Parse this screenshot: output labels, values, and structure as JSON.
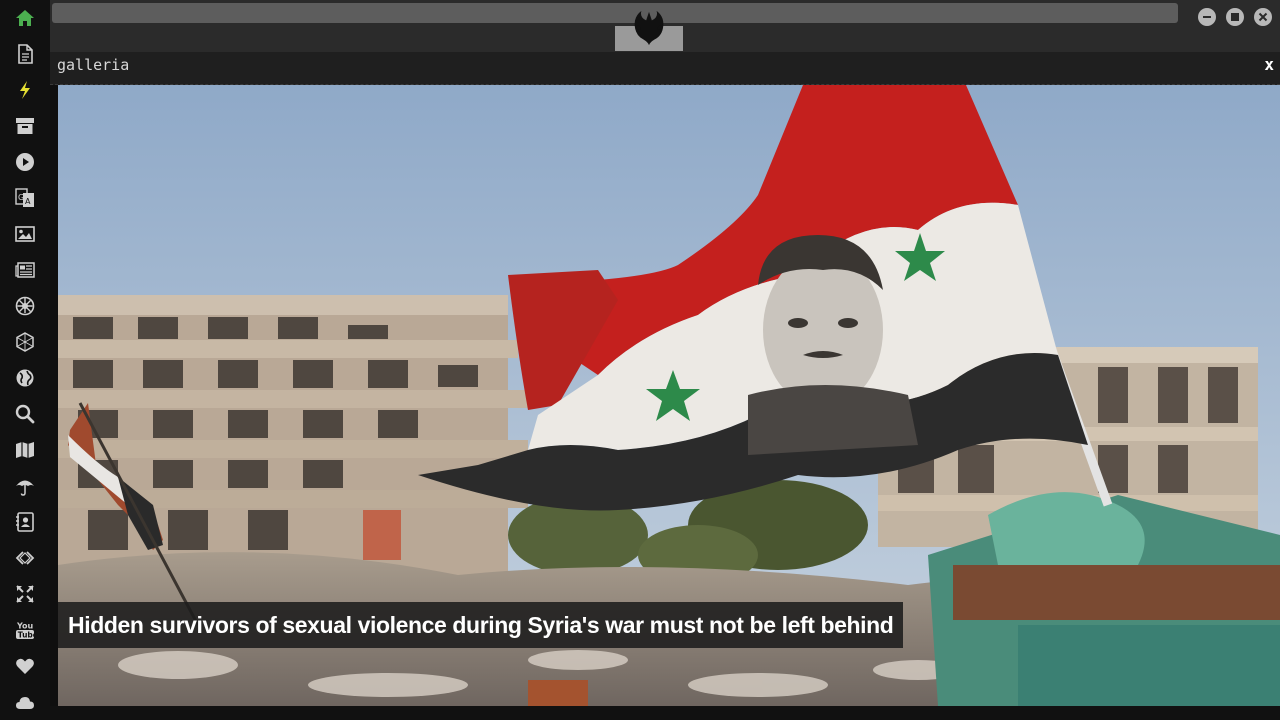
{
  "panel": {
    "title": "galleria",
    "close_label": "x"
  },
  "gallery": {
    "caption": "Hidden survivors of sexual violence during Syria's war must not be left behind"
  },
  "sidebar": {
    "items": [
      {
        "icon": "home-icon",
        "active": true
      },
      {
        "icon": "document-icon"
      },
      {
        "icon": "lightning-icon"
      },
      {
        "icon": "archive-icon"
      },
      {
        "icon": "play-icon"
      },
      {
        "icon": "translate-icon"
      },
      {
        "icon": "image-icon"
      },
      {
        "icon": "newspaper-icon"
      },
      {
        "icon": "galactic-empire-icon"
      },
      {
        "icon": "hexagon-icon"
      },
      {
        "icon": "globe-icon"
      },
      {
        "icon": "search-icon"
      },
      {
        "icon": "map-icon"
      },
      {
        "icon": "umbrella-icon"
      },
      {
        "icon": "contact-card-icon"
      },
      {
        "icon": "code-icon"
      },
      {
        "icon": "expand-icon"
      },
      {
        "icon": "youtube-icon"
      },
      {
        "icon": "heart-icon"
      },
      {
        "icon": "cloud-icon"
      }
    ]
  },
  "colors": {
    "active_icon": "#4caf50",
    "icon": "#d0d0d0"
  }
}
